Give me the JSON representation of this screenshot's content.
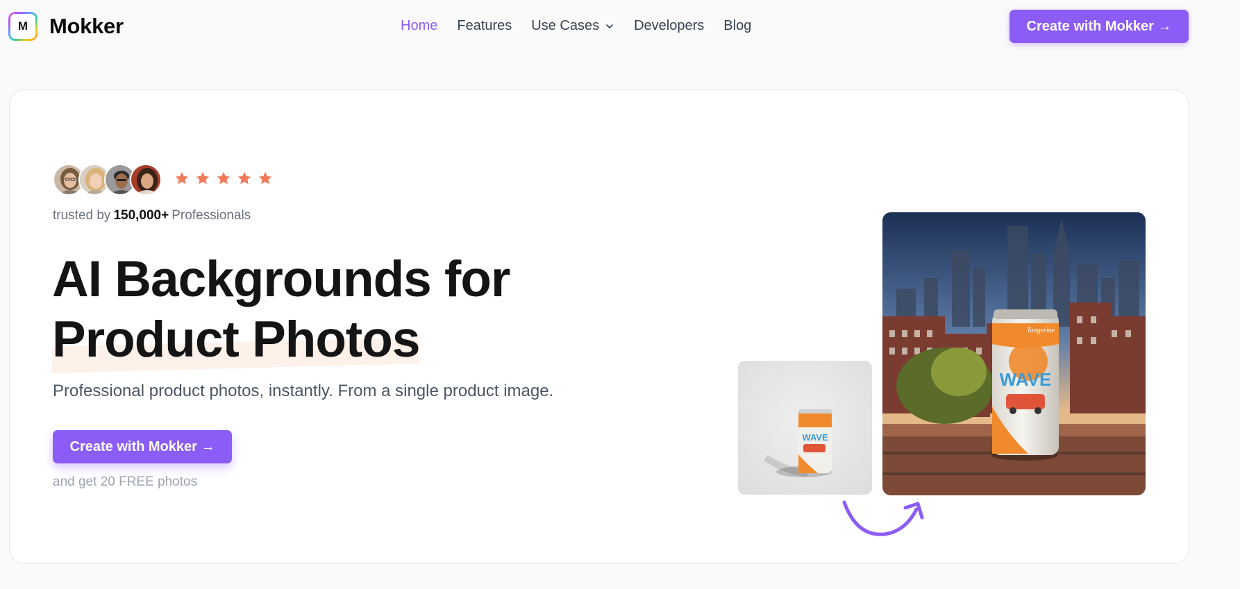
{
  "brand": {
    "logo_letter": "M",
    "name": "Mokker"
  },
  "nav": {
    "items": [
      {
        "label": "Home",
        "active": true
      },
      {
        "label": "Features"
      },
      {
        "label": "Use Cases",
        "has_dropdown": true
      },
      {
        "label": "Developers"
      },
      {
        "label": "Blog"
      }
    ]
  },
  "header_cta": {
    "label": "Create with Mokker →"
  },
  "hero": {
    "rating_stars": 5,
    "trusted_prefix": "trusted by",
    "trusted_count": "150,000+",
    "trusted_suffix": "Professionals",
    "headline_line1": "AI Backgrounds for",
    "headline_line2": "Product Photos",
    "subheadline": "Professional product photos, instantly. From a single product image.",
    "cta_label": "Create with Mokker →",
    "cta_note": "and get 20 FREE photos"
  },
  "can_label": {
    "brand": "WAVE",
    "flavor": "Tangerine"
  },
  "colors": {
    "accent": "#8b5cf6",
    "star": "#f07a5a",
    "headline_highlight": "#fdf1ea",
    "can_orange": "#f08a2c",
    "can_blue": "#3a9bd8"
  }
}
